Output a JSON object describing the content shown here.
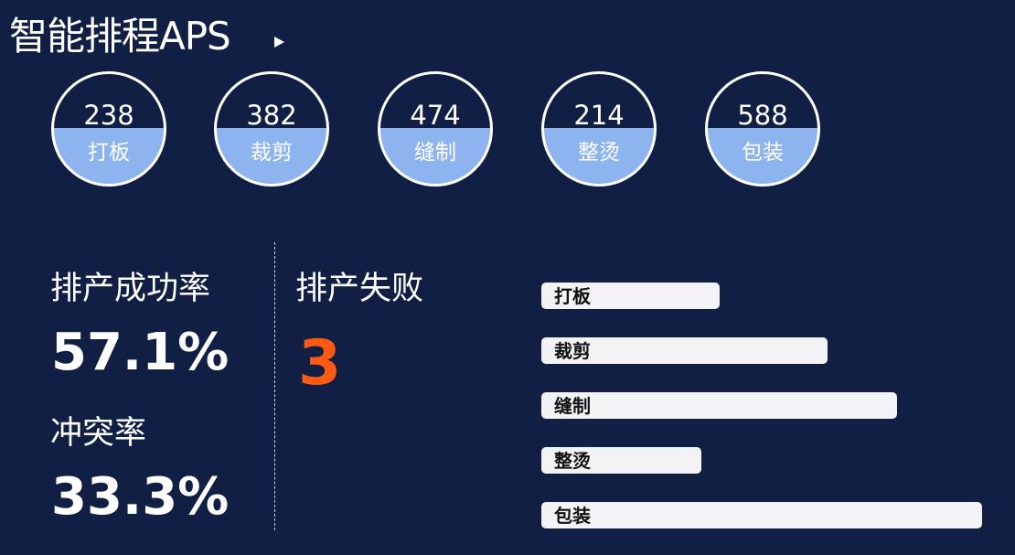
{
  "header": {
    "title": "智能排程APS"
  },
  "process_counts": [
    {
      "value": "238",
      "label": "打板"
    },
    {
      "value": "382",
      "label": "裁剪"
    },
    {
      "value": "474",
      "label": "缝制"
    },
    {
      "value": "214",
      "label": "整烫"
    },
    {
      "value": "588",
      "label": "包装"
    }
  ],
  "metrics": {
    "success_rate_label": "排产成功率",
    "success_rate_value": "57.1%",
    "conflict_rate_label": "冲突率",
    "conflict_rate_value": "33.3%",
    "failure_label": "排产失败",
    "failure_value": "3"
  },
  "chart_data": {
    "type": "bar",
    "categories": [
      "打板",
      "裁剪",
      "缝制",
      "整烫",
      "包装"
    ],
    "values": [
      238,
      382,
      474,
      214,
      588
    ]
  },
  "colors": {
    "background": "#121f44",
    "circle_fill": "#8db4ee",
    "failure_accent": "#ff5a14",
    "bar_fill": "#f3f3f5"
  }
}
